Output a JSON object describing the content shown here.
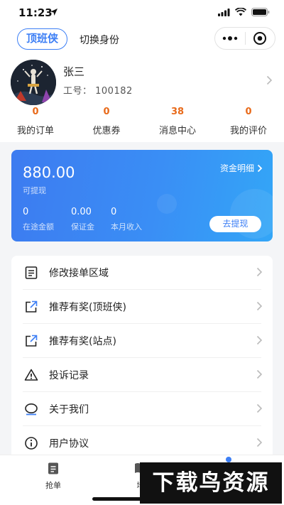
{
  "status": {
    "time": "11:23"
  },
  "header": {
    "role_chip": "顶班侠",
    "switch_label": "切换身份"
  },
  "profile": {
    "name": "张三",
    "employee_id": "工号：  100182",
    "stats": [
      {
        "value": "0",
        "label": "我的订单"
      },
      {
        "value": "0",
        "label": "优惠券"
      },
      {
        "value": "38",
        "label": "消息中心"
      },
      {
        "value": "0",
        "label": "我的评价"
      }
    ]
  },
  "wallet": {
    "balance": "880.00",
    "balance_label": "可提现",
    "detail_link": "资金明细",
    "funds": [
      {
        "value": "0",
        "label": "在途金额"
      },
      {
        "value": "0.00",
        "label": "保证金"
      },
      {
        "value": "0",
        "label": "本月收入"
      }
    ],
    "withdraw_button": "去提现"
  },
  "menu": {
    "items": [
      {
        "label": "修改接单区域",
        "icon": "document-icon"
      },
      {
        "label": "推荐有奖(顶班侠)",
        "icon": "share-icon"
      },
      {
        "label": "推荐有奖(站点)",
        "icon": "share-icon"
      },
      {
        "label": "投诉记录",
        "icon": "warning-icon"
      },
      {
        "label": "关于我们",
        "icon": "chat-bubble-icon"
      },
      {
        "label": "用户协议",
        "icon": "info-icon"
      }
    ]
  },
  "tabbar": {
    "tabs": [
      {
        "label": "抢单",
        "icon": "clipboard-icon"
      },
      {
        "label": "培",
        "icon": "book-icon"
      }
    ]
  },
  "watermark": {
    "text": "下载鸟资源"
  },
  "colors": {
    "accent": "#3d7ff5",
    "stat_number": "#e86a1a"
  }
}
